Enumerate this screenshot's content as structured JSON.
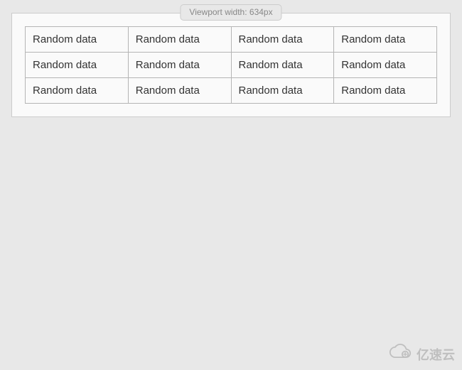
{
  "viewport": {
    "label": "Viewport width: 634px"
  },
  "table": {
    "rows": [
      {
        "cells": [
          "Random data",
          "Random data",
          "Random data",
          "Random data"
        ]
      },
      {
        "cells": [
          "Random data",
          "Random data",
          "Random data",
          "Random data"
        ]
      },
      {
        "cells": [
          "Random data",
          "Random data",
          "Random data",
          "Random data"
        ]
      }
    ]
  },
  "watermark": {
    "text": "亿速云",
    "icon": "cloud-logo-icon"
  }
}
